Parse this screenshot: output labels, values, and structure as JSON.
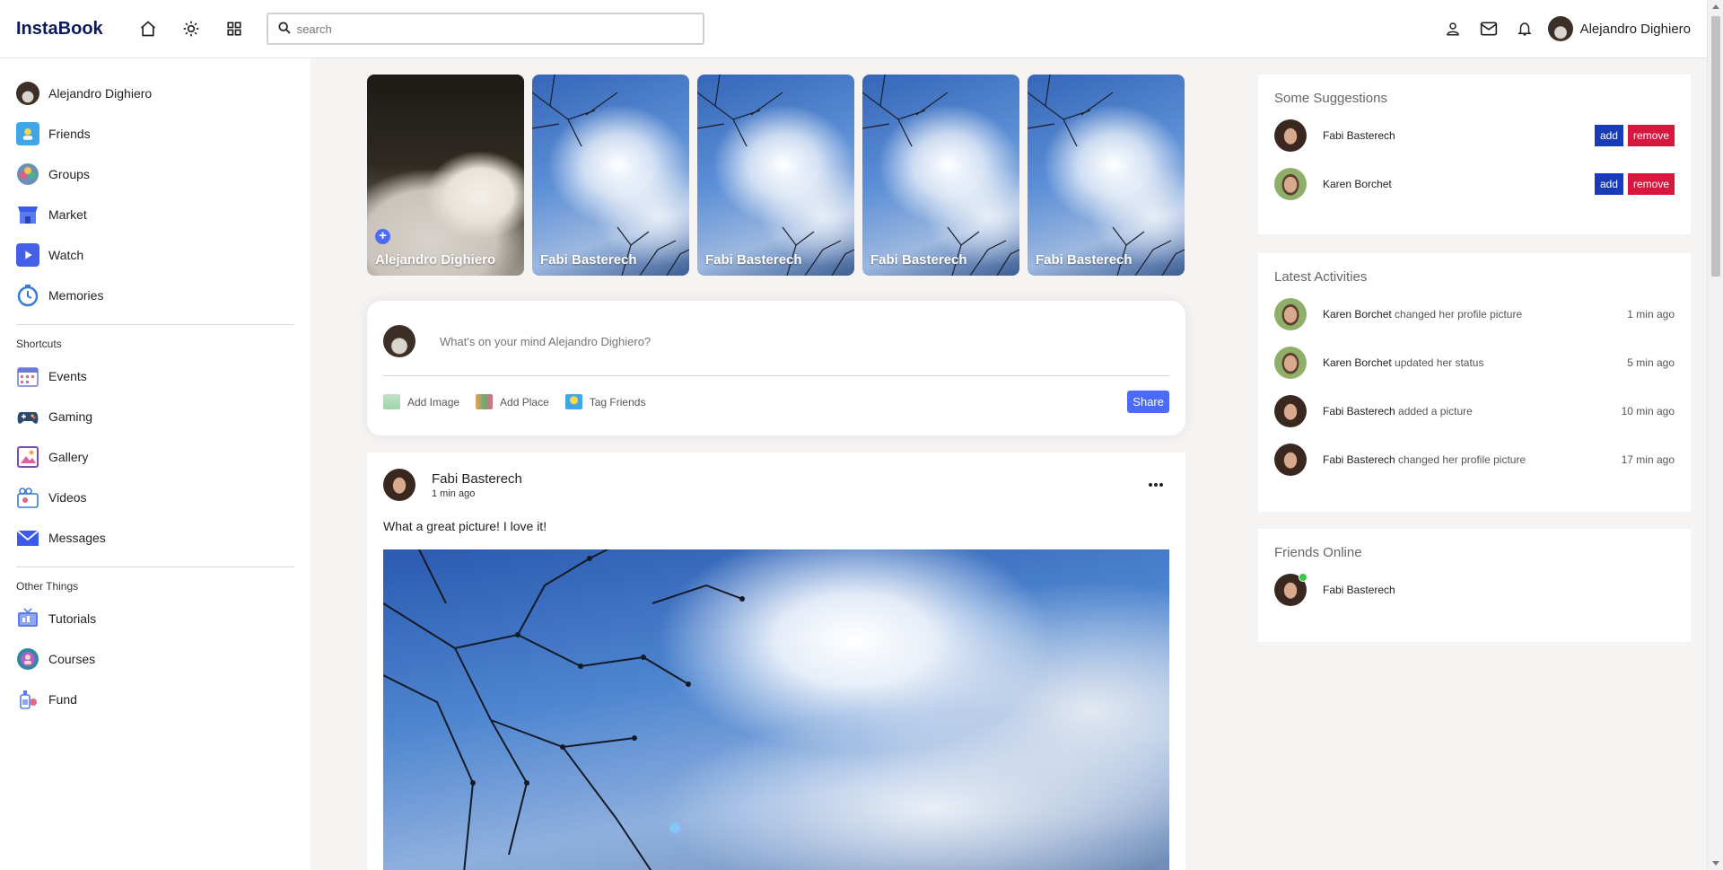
{
  "navbar": {
    "logo": "InstaBook",
    "search_placeholder": "search",
    "user_name": "Alejandro Dighiero"
  },
  "sidebar": {
    "items": [
      {
        "label": "Alejandro Dighiero",
        "icon": "user-avatar"
      },
      {
        "label": "Friends",
        "icon": "friends-icon"
      },
      {
        "label": "Groups",
        "icon": "groups-icon"
      },
      {
        "label": "Market",
        "icon": "market-icon"
      },
      {
        "label": "Watch",
        "icon": "watch-icon"
      },
      {
        "label": "Memories",
        "icon": "memories-icon"
      }
    ],
    "shortcuts_title": "Shortcuts",
    "shortcuts": [
      {
        "label": "Events",
        "icon": "events-icon"
      },
      {
        "label": "Gaming",
        "icon": "gaming-icon"
      },
      {
        "label": "Gallery",
        "icon": "gallery-icon"
      },
      {
        "label": "Videos",
        "icon": "videos-icon"
      },
      {
        "label": "Messages",
        "icon": "messages-icon"
      }
    ],
    "other_title": "Other Things",
    "other": [
      {
        "label": "Tutorials",
        "icon": "tutorials-icon"
      },
      {
        "label": "Courses",
        "icon": "courses-icon"
      },
      {
        "label": "Fund",
        "icon": "fund-icon"
      }
    ]
  },
  "stories": [
    {
      "name": "Alejandro Dighiero"
    },
    {
      "name": "Fabi Basterech"
    },
    {
      "name": "Fabi Basterech"
    },
    {
      "name": "Fabi Basterech"
    },
    {
      "name": "Fabi Basterech"
    }
  ],
  "share": {
    "placeholder": "What's on your mind Alejandro Dighiero?",
    "add_image": "Add Image",
    "add_place": "Add Place",
    "tag_friends": "Tag Friends",
    "share_button": "Share"
  },
  "post": {
    "author": "Fabi Basterech",
    "time": "1 min ago",
    "text": "What a great picture! I love it!"
  },
  "suggestions": {
    "title": "Some Suggestions",
    "add_label": "add",
    "remove_label": "remove",
    "people": [
      {
        "name": "Fabi Basterech"
      },
      {
        "name": "Karen Borchet"
      }
    ]
  },
  "activities": {
    "title": "Latest Activities",
    "items": [
      {
        "name": "Karen Borchet",
        "action": " changed her profile picture",
        "time": "1 min ago"
      },
      {
        "name": "Karen Borchet",
        "action": " updated her status",
        "time": "5 min ago"
      },
      {
        "name": "Fabi Basterech",
        "action": " added a picture",
        "time": "10 min ago"
      },
      {
        "name": "Fabi Basterech",
        "action": " changed her profile picture",
        "time": "17 min ago"
      }
    ]
  },
  "friends_online": {
    "title": "Friends Online",
    "items": [
      {
        "name": "Fabi Basterech"
      }
    ]
  },
  "colors": {
    "brand": "#0b1a5e",
    "accent": "#4b6bf5",
    "add": "#1a3bb8",
    "remove": "#d7173d",
    "online": "#2ecc40"
  }
}
